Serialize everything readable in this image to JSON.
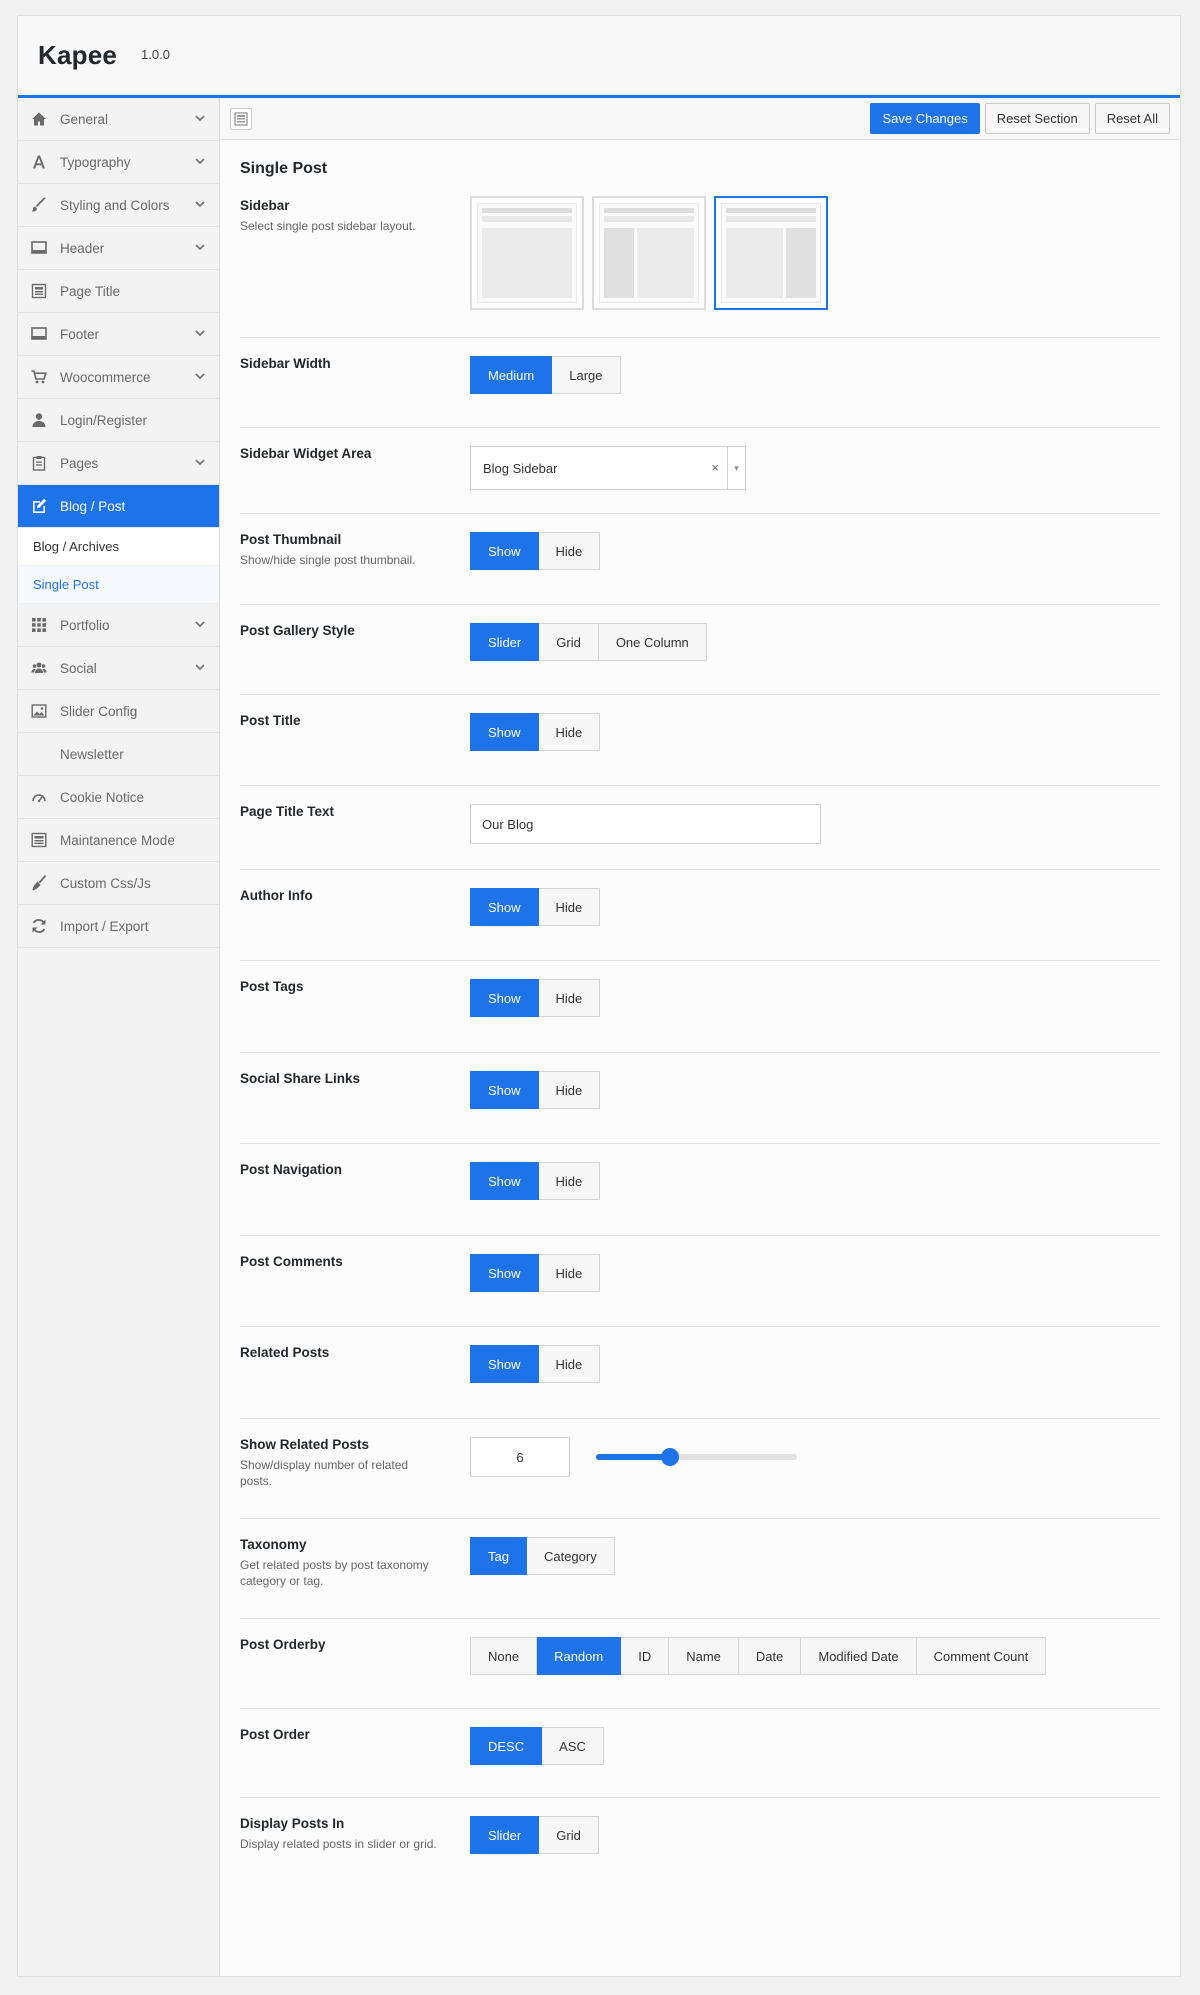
{
  "app": {
    "name": "Kapee",
    "version": "1.0.0"
  },
  "toolbar": {
    "save": "Save Changes",
    "reset_section": "Reset Section",
    "reset_all": "Reset All"
  },
  "sidebar": {
    "items": [
      {
        "label": "General",
        "icon": "home-icon",
        "chevron": true
      },
      {
        "label": "Typography",
        "icon": "typography-icon",
        "chevron": true
      },
      {
        "label": "Styling and Colors",
        "icon": "brush-icon",
        "chevron": true
      },
      {
        "label": "Header",
        "icon": "header-icon",
        "chevron": true
      },
      {
        "label": "Page Title",
        "icon": "page-title-icon",
        "chevron": false
      },
      {
        "label": "Footer",
        "icon": "footer-icon",
        "chevron": true
      },
      {
        "label": "Woocommerce",
        "icon": "cart-icon",
        "chevron": true
      },
      {
        "label": "Login/Register",
        "icon": "user-icon",
        "chevron": false
      },
      {
        "label": "Pages",
        "icon": "clipboard-icon",
        "chevron": true
      },
      {
        "label": "Blog / Post",
        "icon": "edit-icon",
        "chevron": false,
        "active": true
      },
      {
        "label": "Portfolio",
        "icon": "grid-icon",
        "chevron": true
      },
      {
        "label": "Social",
        "icon": "users-icon",
        "chevron": true
      },
      {
        "label": "Slider Config",
        "icon": "image-icon",
        "chevron": false
      },
      {
        "label": "Newsletter",
        "icon": "mail-icon",
        "chevron": false
      },
      {
        "label": "Cookie Notice",
        "icon": "cookie-icon",
        "chevron": false
      },
      {
        "label": "Maintanence Mode",
        "icon": "window-icon",
        "chevron": false
      },
      {
        "label": "Custom Css/Js",
        "icon": "broom-icon",
        "chevron": false
      },
      {
        "label": "Import / Export",
        "icon": "refresh-icon",
        "chevron": false
      }
    ],
    "sub_items": [
      {
        "label": "Blog / Archives",
        "current": false
      },
      {
        "label": "Single Post",
        "current": true
      }
    ]
  },
  "section": {
    "title": "Single Post",
    "sidebar": {
      "label": "Sidebar",
      "desc": "Select single post sidebar layout."
    },
    "sidebar_width": {
      "label": "Sidebar Width",
      "options": [
        "Medium",
        "Large"
      ],
      "selected": "Medium"
    },
    "sidebar_widget_area": {
      "label": "Sidebar Widget Area",
      "value": "Blog Sidebar",
      "clear": "×",
      "arrow": "▾"
    },
    "post_thumbnail": {
      "label": "Post Thumbnail",
      "desc": "Show/hide single post thumbnail.",
      "options": [
        "Show",
        "Hide"
      ],
      "selected": "Show"
    },
    "post_gallery_style": {
      "label": "Post Gallery Style",
      "options": [
        "Slider",
        "Grid",
        "One Column"
      ],
      "selected": "Slider"
    },
    "post_title": {
      "label": "Post Title",
      "options": [
        "Show",
        "Hide"
      ],
      "selected": "Show"
    },
    "page_title_text": {
      "label": "Page Title Text",
      "value": "Our Blog"
    },
    "author_info": {
      "label": "Author Info",
      "options": [
        "Show",
        "Hide"
      ],
      "selected": "Show"
    },
    "post_tags": {
      "label": "Post Tags",
      "options": [
        "Show",
        "Hide"
      ],
      "selected": "Show"
    },
    "social_share_links": {
      "label": "Social Share Links",
      "options": [
        "Show",
        "Hide"
      ],
      "selected": "Show"
    },
    "post_navigation": {
      "label": "Post Navigation",
      "options": [
        "Show",
        "Hide"
      ],
      "selected": "Show"
    },
    "post_comments": {
      "label": "Post Comments",
      "options": [
        "Show",
        "Hide"
      ],
      "selected": "Show"
    },
    "related_posts": {
      "label": "Related Posts",
      "options": [
        "Show",
        "Hide"
      ],
      "selected": "Show"
    },
    "show_related_posts": {
      "label": "Show Related Posts",
      "desc": "Show/display number of related posts.",
      "value": "6",
      "slider_fraction": 0.37
    },
    "taxonomy": {
      "label": "Taxonomy",
      "desc": "Get related posts by post taxonomy category or tag.",
      "options": [
        "Tag",
        "Category"
      ],
      "selected": "Tag"
    },
    "post_orderby": {
      "label": "Post Orderby",
      "options": [
        "None",
        "Random",
        "ID",
        "Name",
        "Date",
        "Modified Date",
        "Comment Count"
      ],
      "selected": "Random"
    },
    "post_order": {
      "label": "Post Order",
      "options": [
        "DESC",
        "ASC"
      ],
      "selected": "DESC"
    },
    "display_posts_in": {
      "label": "Display Posts In",
      "desc": "Display related posts in slider or grid.",
      "options": [
        "Slider",
        "Grid"
      ],
      "selected": "Slider"
    }
  },
  "colors": {
    "accent": "#1e73e8"
  }
}
